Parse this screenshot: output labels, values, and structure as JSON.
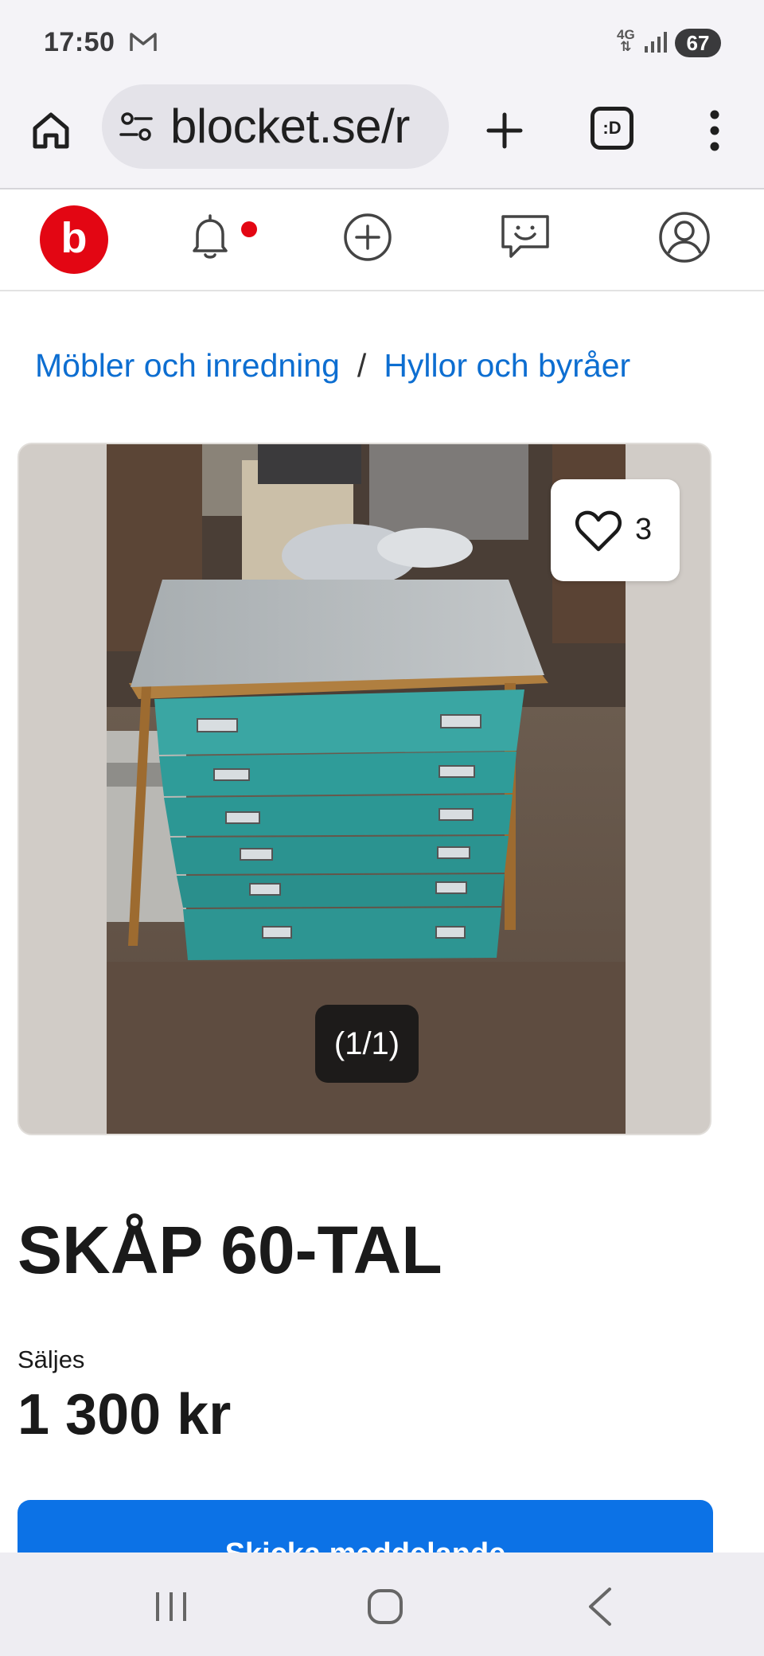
{
  "status_bar": {
    "time": "17:50",
    "network": "4G",
    "battery": "67",
    "icons": [
      "gmail-icon",
      "signal-icon"
    ]
  },
  "browser": {
    "url": "blocket.se/r",
    "icons": [
      "home-icon",
      "site-settings-icon",
      "new-tab-icon",
      "tab-switcher-icon",
      "more-menu-icon"
    ],
    "tab_switcher_label": ":D"
  },
  "site_nav": {
    "logo_letter": "b",
    "icons": [
      "notifications-bell-icon",
      "create-ad-plus-icon",
      "messages-icon",
      "profile-icon"
    ],
    "colors": {
      "brand": "#e30613",
      "link": "#0d6ed1",
      "primary_button": "#0c72e6"
    }
  },
  "breadcrumb": {
    "items": [
      "Möbler och inredning",
      "Hyllor och byråer"
    ],
    "separator": "/"
  },
  "gallery": {
    "favorite_count": "3",
    "image_counter": "(1/1)"
  },
  "ad": {
    "title": "SKÅP 60-TAL",
    "type": "Säljes",
    "price": "1 300 kr",
    "send_button": "Skicka meddelande"
  },
  "android_nav": {
    "icons": [
      "recent-apps-icon",
      "home-button-icon",
      "back-icon"
    ]
  }
}
